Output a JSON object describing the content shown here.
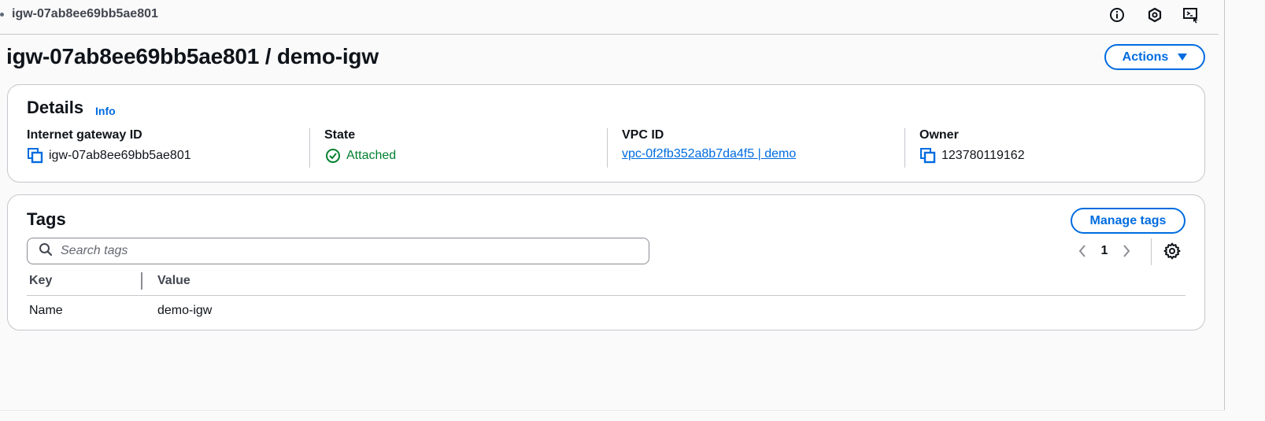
{
  "topbar": {
    "breadcrumb": "igw-07ab8ee69bb5ae801",
    "icons": [
      "info-circle-icon",
      "shield-hexagon-icon",
      "cloudshell-icon"
    ]
  },
  "page": {
    "title": "igw-07ab8ee69bb5ae801 / demo-igw",
    "actions_label": "Actions"
  },
  "details": {
    "heading": "Details",
    "info_label": "Info",
    "columns": [
      {
        "label": "Internet gateway ID",
        "value": "igw-07ab8ee69bb5ae801"
      },
      {
        "label": "State",
        "value": "Attached"
      },
      {
        "label": "VPC ID",
        "value": "vpc-0f2fb352a8b7da4f5 | demo"
      },
      {
        "label": "Owner",
        "value": "123780119162"
      }
    ]
  },
  "tags": {
    "heading": "Tags",
    "manage_label": "Manage tags",
    "search_placeholder": "Search tags",
    "page_number": "1",
    "headers": {
      "key": "Key",
      "value": "Value"
    },
    "rows": [
      {
        "key": "Name",
        "value": "demo-igw"
      }
    ]
  },
  "colors": {
    "accent": "#006ce0",
    "success": "#00802f",
    "border": "#c6c6cd"
  }
}
